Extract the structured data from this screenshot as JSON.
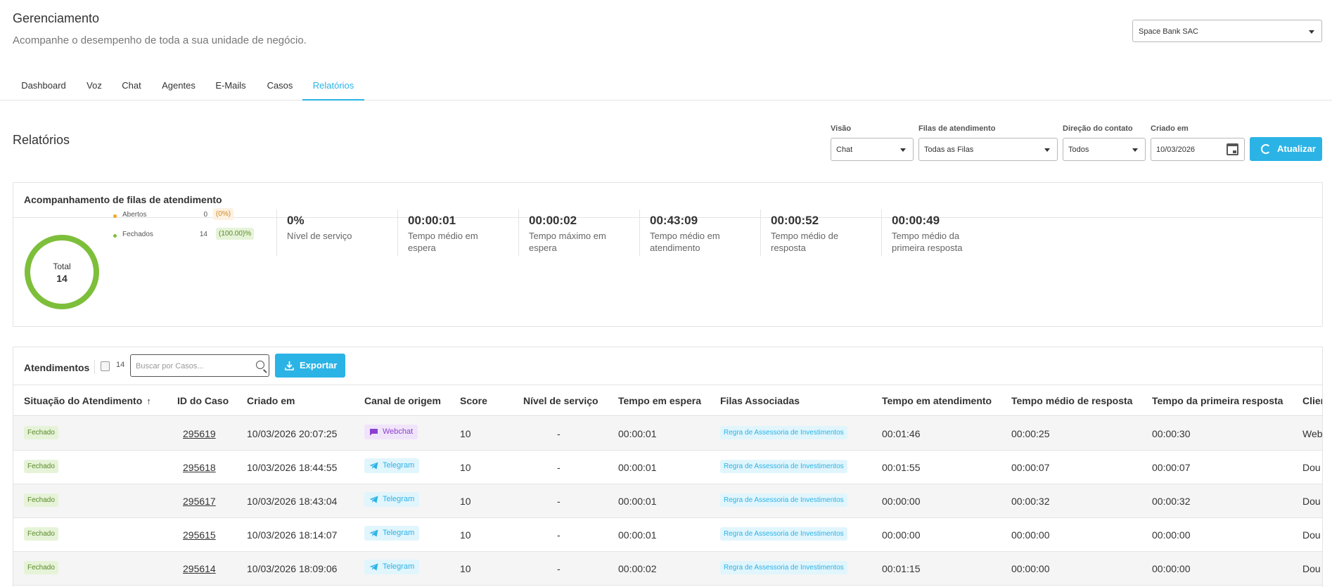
{
  "header": {
    "title": "Gerenciamento",
    "subtitle": "Acompanhe o desempenho de toda a sua unidade de negócio.",
    "unit_select": "Space Bank SAC"
  },
  "tabs": [
    "Dashboard",
    "Voz",
    "Chat",
    "Agentes",
    "E-Mails",
    "Casos",
    "Relatórios"
  ],
  "active_tab": "Relatórios",
  "reports": {
    "title": "Relatórios",
    "filters": {
      "visao_label": "Visão",
      "visao_value": "Chat",
      "filas_label": "Filas de atendimento",
      "filas_value": "Todas as Filas",
      "direcao_label": "Direção do contato",
      "direcao_value": "Todos",
      "criado_label": "Criado em",
      "criado_value": "10/03/2026"
    },
    "refresh_label": "Atualizar"
  },
  "queue_card": {
    "title": "Acompanhamento de filas de atendimento",
    "total_label": "Total",
    "total_value": "14",
    "legend": [
      {
        "label": "Abertos",
        "count": "0",
        "pct": "(0%)",
        "color": "#f5a623",
        "fraction": 0
      },
      {
        "label": "Fechados",
        "count": "14",
        "pct": "(100.00)%",
        "color": "#7dbf3a",
        "fraction": 1
      }
    ],
    "kpis": [
      {
        "value": "0%",
        "label": "Nível de serviço"
      },
      {
        "value": "00:00:01",
        "label": "Tempo médio em espera"
      },
      {
        "value": "00:00:02",
        "label": "Tempo máximo em espera"
      },
      {
        "value": "00:43:09",
        "label": "Tempo médio em atendimento"
      },
      {
        "value": "00:00:52",
        "label": "Tempo médio de resposta"
      },
      {
        "value": "00:00:49",
        "label": "Tempo médio da primeira resposta"
      }
    ]
  },
  "atendimentos": {
    "title": "Atendimentos",
    "count": "14",
    "search_placeholder": "Buscar por Casos...",
    "export_label": "Exportar",
    "columns": [
      "Situação do Atendimento",
      "ID do Caso",
      "Criado em",
      "Canal de origem",
      "Score",
      "Nível de serviço",
      "Tempo em espera",
      "Filas Associadas",
      "Tempo em atendimento",
      "Tempo médio de resposta",
      "Tempo da primeira resposta",
      "Clien"
    ],
    "sort_icon": "arrow-up-icon",
    "rows": [
      {
        "status": "Fechado",
        "id": "295619",
        "created": "10/03/2026 20:07:25",
        "channel": "Webchat",
        "channel_icon": "chat-bubble-icon",
        "score": "10",
        "service_level": "-",
        "wait": "00:00:01",
        "queue": "Regra de Assessoria de Investimentos",
        "handling": "00:01:46",
        "avg_response": "00:00:25",
        "first_response": "00:00:30",
        "client": "Web"
      },
      {
        "status": "Fechado",
        "id": "295618",
        "created": "10/03/2026 18:44:55",
        "channel": "Telegram",
        "channel_icon": "telegram-icon",
        "score": "10",
        "service_level": "-",
        "wait": "00:00:01",
        "queue": "Regra de Assessoria de Investimentos",
        "handling": "00:01:55",
        "avg_response": "00:00:07",
        "first_response": "00:00:07",
        "client": "Dou"
      },
      {
        "status": "Fechado",
        "id": "295617",
        "created": "10/03/2026 18:43:04",
        "channel": "Telegram",
        "channel_icon": "telegram-icon",
        "score": "10",
        "service_level": "-",
        "wait": "00:00:01",
        "queue": "Regra de Assessoria de Investimentos",
        "handling": "00:00:00",
        "avg_response": "00:00:32",
        "first_response": "00:00:32",
        "client": "Dou"
      },
      {
        "status": "Fechado",
        "id": "295615",
        "created": "10/03/2026 18:14:07",
        "channel": "Telegram",
        "channel_icon": "telegram-icon",
        "score": "10",
        "service_level": "-",
        "wait": "00:00:01",
        "queue": "Regra de Assessoria de Investimentos",
        "handling": "00:00:00",
        "avg_response": "00:00:00",
        "first_response": "00:00:00",
        "client": "Dou"
      },
      {
        "status": "Fechado",
        "id": "295614",
        "created": "10/03/2026 18:09:06",
        "channel": "Telegram",
        "channel_icon": "telegram-icon",
        "score": "10",
        "service_level": "-",
        "wait": "00:00:02",
        "queue": "Regra de Assessoria de Investimentos",
        "handling": "00:01:15",
        "avg_response": "00:00:00",
        "first_response": "00:00:00",
        "client": "Dou"
      }
    ]
  },
  "colors": {
    "accent": "#2bb3e6",
    "closed_green": "#7dbf3a",
    "open_orange": "#f5a623",
    "webchat_purple": "#8a3fcf"
  }
}
